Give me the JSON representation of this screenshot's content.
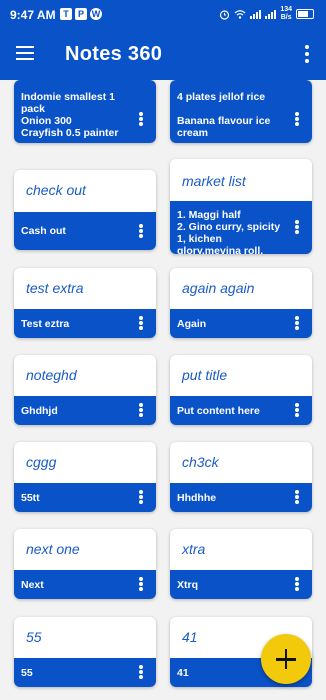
{
  "status_bar": {
    "time": "9:47 AM",
    "app_icons": [
      "T",
      "P",
      "W"
    ],
    "net_speed_value": "134",
    "net_speed_unit": "B/s"
  },
  "app_bar": {
    "title": "Notes 360",
    "menu_icon": "menu-icon",
    "more_icon": "more-vert-icon"
  },
  "notes": [
    {
      "title": "",
      "content": "Indomie smallest 1 pack\nOnion 300\nCrayfish 0.5 painter"
    },
    {
      "title": "",
      "content": "4 plates jellof rice\n\nBanana flavour ice cream"
    },
    {
      "title": "check out",
      "content": "Cash out"
    },
    {
      "title": "market list",
      "content": "1. Maggi half\n2. Gino curry, spicity 1, kichen glory,mevina roll."
    },
    {
      "title": "test extra",
      "content": "Test eztra"
    },
    {
      "title": "again again",
      "content": "Again"
    },
    {
      "title": "noteghd",
      "content": "Ghdhjd"
    },
    {
      "title": "put title",
      "content": "Put content here"
    },
    {
      "title": "cggg",
      "content": "55tt"
    },
    {
      "title": "ch3ck",
      "content": "Hhdhhe"
    },
    {
      "title": "next one",
      "content": "Next"
    },
    {
      "title": "xtra",
      "content": "Xtrq"
    },
    {
      "title": "55",
      "content": "55"
    },
    {
      "title": "41",
      "content": "41"
    }
  ],
  "fab": {
    "icon": "plus-icon"
  },
  "colors": {
    "primary": "#0a52c8",
    "accent": "#f3c90c",
    "title_text": "#1a5bc9"
  }
}
